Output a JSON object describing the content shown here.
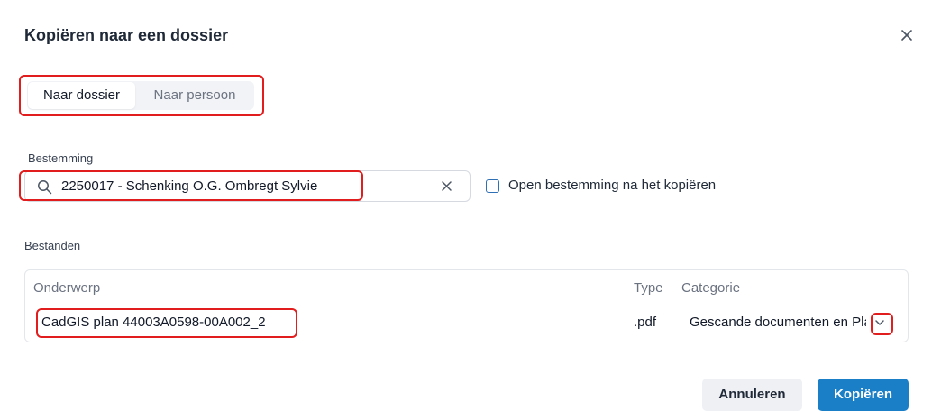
{
  "dialog": {
    "title": "Kopiëren naar een dossier",
    "close_icon": "close-icon"
  },
  "tabs": [
    {
      "label": "Naar dossier",
      "active": true
    },
    {
      "label": "Naar persoon",
      "active": false
    }
  ],
  "destination": {
    "label": "Bestemming",
    "value": "2250017 - Schenking O.G. Ombregt Sylvie",
    "search_icon": "search-icon",
    "clear_icon": "clear-icon",
    "open_after_copy": {
      "label": "Open bestemming na het kopiëren",
      "checked": false
    }
  },
  "files": {
    "label": "Bestanden",
    "columns": [
      "Onderwerp",
      "Type",
      "Categorie"
    ],
    "rows": [
      {
        "subject": "CadGIS plan 44003A0598-00A002_2",
        "type": ".pdf",
        "category": "Gescande documenten en Plannen"
      }
    ]
  },
  "actions": {
    "cancel": "Annuleren",
    "copy": "Kopiëren"
  },
  "colors": {
    "primary": "#1b7fc8",
    "highlight": "#e11d1d",
    "checkbox": "#2f6fb3"
  }
}
